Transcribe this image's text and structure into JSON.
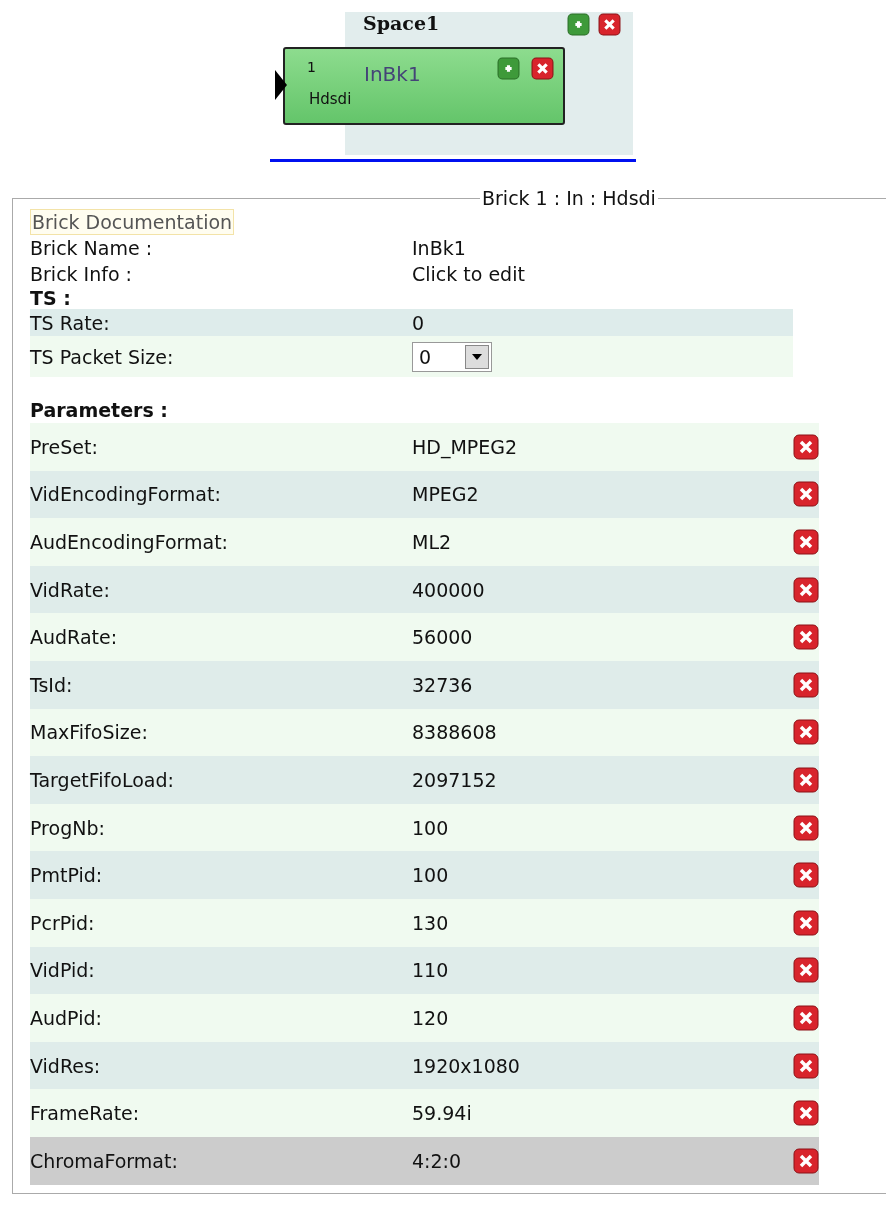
{
  "canvas": {
    "space": {
      "title": "Space1"
    },
    "brick": {
      "number": "1",
      "name": "InBk1",
      "type": "Hdsdi"
    }
  },
  "panel": {
    "legend": "Brick 1 : In : Hdsdi",
    "doc_link": "Brick Documentation",
    "info": [
      {
        "label": "Brick Name :",
        "value": "InBk1"
      },
      {
        "label": "Brick Info :",
        "value": "Click to edit"
      }
    ],
    "ts_heading": "TS :",
    "ts_rows": [
      {
        "kind": "text",
        "label": "TS Rate:",
        "value": "0"
      },
      {
        "kind": "select",
        "label": "TS Packet Size:",
        "value": "0"
      }
    ],
    "params_heading": "Parameters :",
    "parameters": [
      {
        "label": "PreSet:",
        "value": "HD_MPEG2",
        "selected": false
      },
      {
        "label": "VidEncodingFormat:",
        "value": "MPEG2",
        "selected": false
      },
      {
        "label": "AudEncodingFormat:",
        "value": "ML2",
        "selected": false
      },
      {
        "label": "VidRate:",
        "value": "400000",
        "selected": false
      },
      {
        "label": "AudRate:",
        "value": "56000",
        "selected": false
      },
      {
        "label": "TsId:",
        "value": "32736",
        "selected": false
      },
      {
        "label": "MaxFifoSize:",
        "value": "8388608",
        "selected": false
      },
      {
        "label": "TargetFifoLoad:",
        "value": "2097152",
        "selected": false
      },
      {
        "label": "ProgNb:",
        "value": "100",
        "selected": false
      },
      {
        "label": "PmtPid:",
        "value": "100",
        "selected": false
      },
      {
        "label": "PcrPid:",
        "value": "130",
        "selected": false
      },
      {
        "label": "VidPid:",
        "value": "110",
        "selected": false
      },
      {
        "label": "AudPid:",
        "value": "120",
        "selected": false
      },
      {
        "label": "VidRes:",
        "value": "1920x1080",
        "selected": false
      },
      {
        "label": "FrameRate:",
        "value": "59.94i",
        "selected": false
      },
      {
        "label": "ChromaFormat:",
        "value": "4:2:0",
        "selected": true
      }
    ]
  }
}
